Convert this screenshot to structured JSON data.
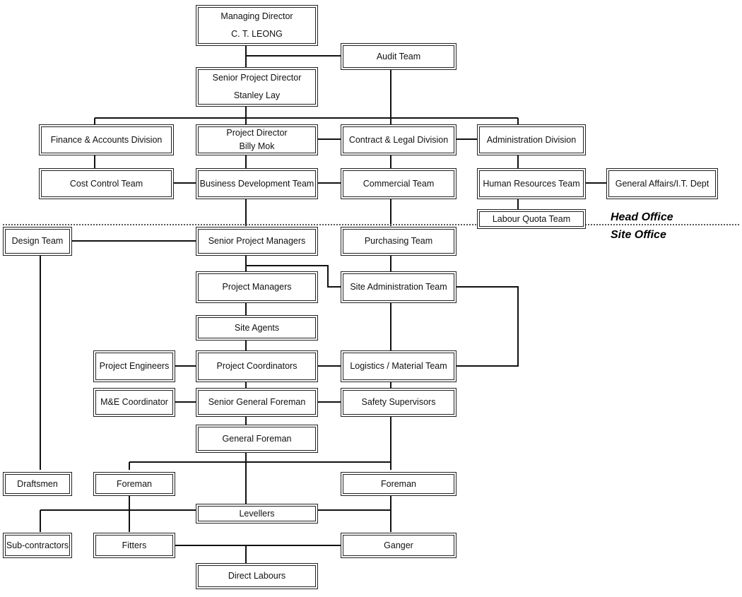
{
  "sections": {
    "head_office": "Head Office",
    "site_office": "Site Office"
  },
  "nodes": {
    "md": [
      "Managing Director",
      "C. T. LEONG"
    ],
    "audit": [
      "Audit Team"
    ],
    "spd": [
      "Senior Project Director",
      "Stanley Lay"
    ],
    "finance": [
      "Finance & Accounts Division"
    ],
    "pd": [
      "Project Director",
      "Billy Mok"
    ],
    "contract": [
      "Contract & Legal Division"
    ],
    "admin": [
      "Administration Division"
    ],
    "cost": [
      "Cost Control Team"
    ],
    "bizdev": [
      "Business Development Team"
    ],
    "commercial": [
      "Commercial Team"
    ],
    "hr": [
      "Human Resources Team"
    ],
    "ga": [
      "General Affairs/I.T. Dept"
    ],
    "labour": [
      "Labour Quota Team"
    ],
    "design": [
      "Design Team"
    ],
    "spm": [
      "Senior Project Managers"
    ],
    "purchasing": [
      "Purchasing Team"
    ],
    "pm": [
      "Project Managers"
    ],
    "siteadmin": [
      "Site Administration Team"
    ],
    "agents": [
      "Site Agents"
    ],
    "engineers": [
      "Project Engineers"
    ],
    "coordinators": [
      "Project Coordinators"
    ],
    "logistics": [
      "Logistics / Material Team"
    ],
    "me": [
      "M&E Coordinator"
    ],
    "sgf": [
      "Senior General Foreman"
    ],
    "safety": [
      "Safety Supervisors"
    ],
    "gf": [
      "General Foreman"
    ],
    "draftsmen": [
      "Draftsmen"
    ],
    "foreman_left": [
      "Foreman"
    ],
    "foreman_right": [
      "Foreman"
    ],
    "levellers": [
      "Levellers"
    ],
    "subcon": [
      "Sub-contractors"
    ],
    "fitters": [
      "Fitters"
    ],
    "ganger": [
      "Ganger"
    ],
    "direct": [
      "Direct Labours"
    ]
  },
  "colors": {
    "line": "#111111",
    "border": "#222222",
    "background": "#ffffff"
  }
}
